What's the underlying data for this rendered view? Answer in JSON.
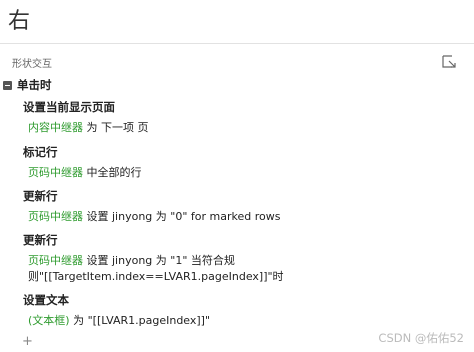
{
  "panel": {
    "title": "右",
    "section_label": "形状交互"
  },
  "event": {
    "label": "单击时"
  },
  "actions": [
    {
      "title": "设置当前显示页面",
      "target": "内容中继器",
      "rest": " 为 下一项 页"
    },
    {
      "title": "标记行",
      "target": "页码中继器",
      "rest": " 中全部的行"
    },
    {
      "title": "更新行",
      "target": "页码中继器",
      "rest": " 设置 jinyong 为 \"0\" for marked rows"
    },
    {
      "title": "更新行",
      "target": "页码中继器",
      "rest": " 设置 jinyong 为 \"1\" 当符合规",
      "rest2": "则\"[[TargetItem.index==LVAR1.pageIndex]]\"时"
    },
    {
      "title": "设置文本",
      "target": "(文本框)",
      "rest": " 为 \"[[LVAR1.pageIndex]]\""
    }
  ],
  "watermark": "CSDN @佑佑52",
  "add_symbol": "+",
  "colors": {
    "target_green": "#2e9b2e",
    "divider": "#e2e2e2"
  }
}
